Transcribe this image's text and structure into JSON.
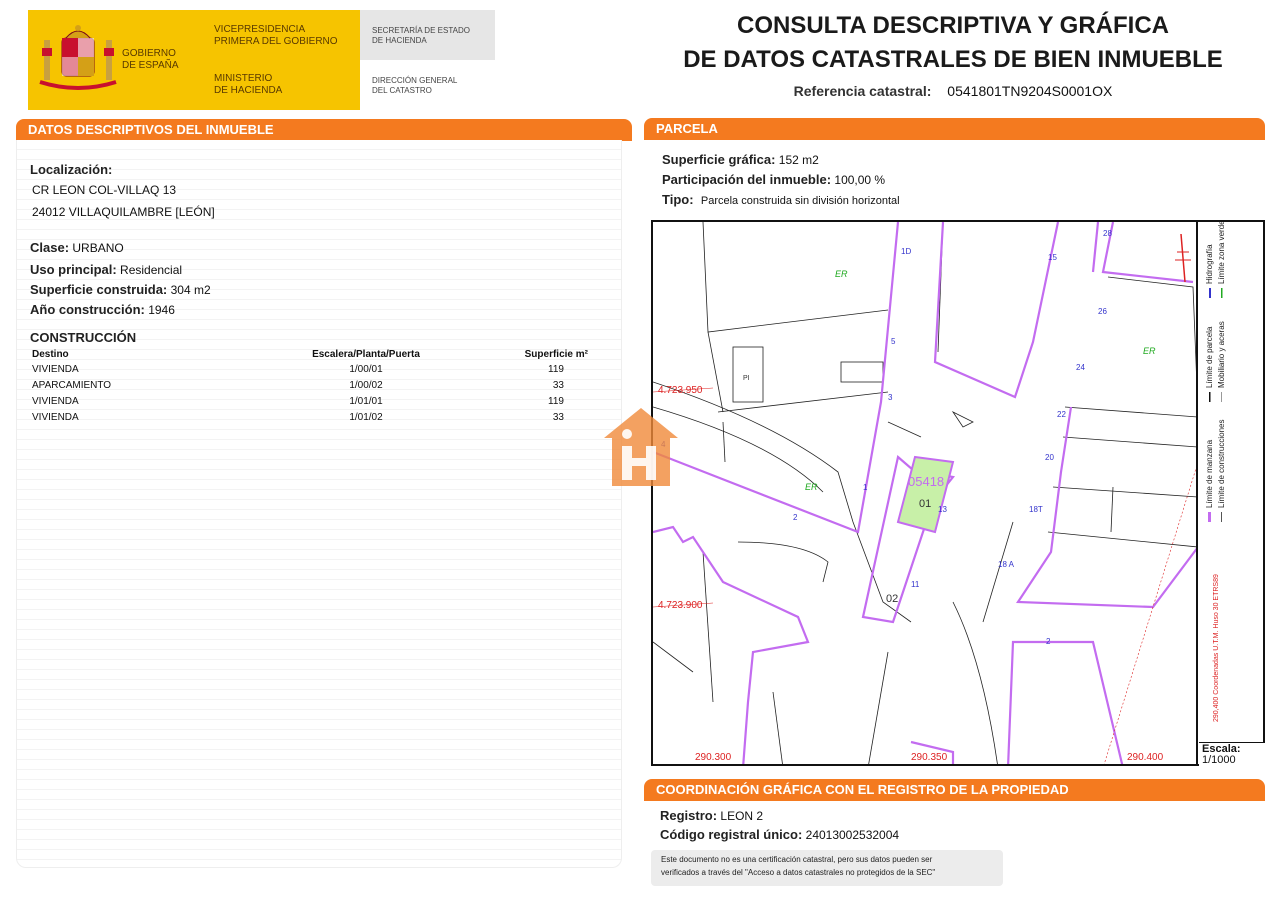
{
  "header": {
    "gov_line1": "GOBIERNO",
    "gov_line2": "DE ESPAÑA",
    "vp_line1": "VICEPRESIDENCIA",
    "vp_line2": "PRIMERA DEL GOBIERNO",
    "min_line1": "MINISTERIO",
    "min_line2": "DE HACIENDA",
    "sec_line1": "SECRETARÍA DE ESTADO",
    "sec_line2": "DE HACIENDA",
    "dg_line1": "DIRECCIÓN GENERAL",
    "dg_line2": "DEL CATASTRO",
    "title_line1": "CONSULTA DESCRIPTIVA Y GRÁFICA",
    "title_line2": "DE DATOS CATASTRALES DE BIEN INMUEBLE",
    "ref_label": "Referencia catastral:",
    "ref_value": "0541801TN9204S0001OX"
  },
  "descriptivos": {
    "heading": "DATOS DESCRIPTIVOS DEL INMUEBLE",
    "loc_label": "Localización:",
    "loc_line1": "CR LEON COL-VILLAQ 13",
    "loc_line2": "24012 VILLAQUILAMBRE [LEÓN]",
    "clase_label": "Clase:",
    "clase_value": "URBANO",
    "uso_label": "Uso principal:",
    "uso_value": "Residencial",
    "sup_label": "Superficie construida:",
    "sup_value": "304 m2",
    "anio_label": "Año construcción:",
    "anio_value": "1946"
  },
  "construccion": {
    "heading": "CONSTRUCCIÓN",
    "columns": [
      "Destino",
      "Escalera/Planta/Puerta",
      "Superficie m²"
    ],
    "rows": [
      [
        "VIVIENDA",
        "1/00/01",
        "119"
      ],
      [
        "APARCAMIENTO",
        "1/00/02",
        "33"
      ],
      [
        "VIVIENDA",
        "1/01/01",
        "119"
      ],
      [
        "VIVIENDA",
        "1/01/02",
        "33"
      ]
    ]
  },
  "parcela": {
    "heading": "PARCELA",
    "sup_label": "Superficie gráfica:",
    "sup_value": "152 m2",
    "part_label": "Participación del inmueble:",
    "part_value": "100,00 %",
    "tipo_label": "Tipo:",
    "tipo_value": "Parcela construida sin división horizontal"
  },
  "map": {
    "labels": {
      "y_top": "4.723.950",
      "y_bottom": "4.723.900",
      "x_left": "290.300",
      "x_mid": "290.350",
      "x_right": "290.400",
      "er": "ER",
      "pi": "PI",
      "parcel": "05418",
      "unit1": "01",
      "unit2": "02",
      "n28": "28",
      "n15": "15",
      "n26": "26",
      "n24": "24",
      "n22": "22",
      "n20": "20",
      "n18t": "18T",
      "n18a": "18 A",
      "n2": "2",
      "n3": "3",
      "n4": "4",
      "n5": "5",
      "n11": "11",
      "n13": "13",
      "n1": "1",
      "n1d": "1D",
      "n2b": "2"
    },
    "legend": {
      "l1": "Límite de manzana",
      "l2": "Límite de parcela",
      "l3": "Hidrografía",
      "l4": "Límite de construcciones",
      "l5": "Mobiliario y aceras",
      "l6": "Límite zona verde",
      "coords": "290,400 Coordenadas U.T.M. Huso 30 ETRS89",
      "scale_label": "Escala:",
      "scale_value": "1/1000"
    }
  },
  "registro": {
    "heading": "COORDINACIÓN GRÁFICA CON EL REGISTRO DE LA PROPIEDAD",
    "reg_label": "Registro:",
    "reg_value": "LEON 2",
    "cru_label": "Código registral único:",
    "cru_value": "24013002532004",
    "note_line1": "Este documento no es una certificación catastral, pero sus datos pueden ser",
    "note_line2": "verificados a través del \"Acceso a datos catastrales no protegidos de la SEC\""
  },
  "colors": {
    "accent": "#f47a1f",
    "gov_yellow": "#f6c400",
    "parcel_purple": "#c36cf0",
    "parcel_green": "#c8f0a8"
  }
}
